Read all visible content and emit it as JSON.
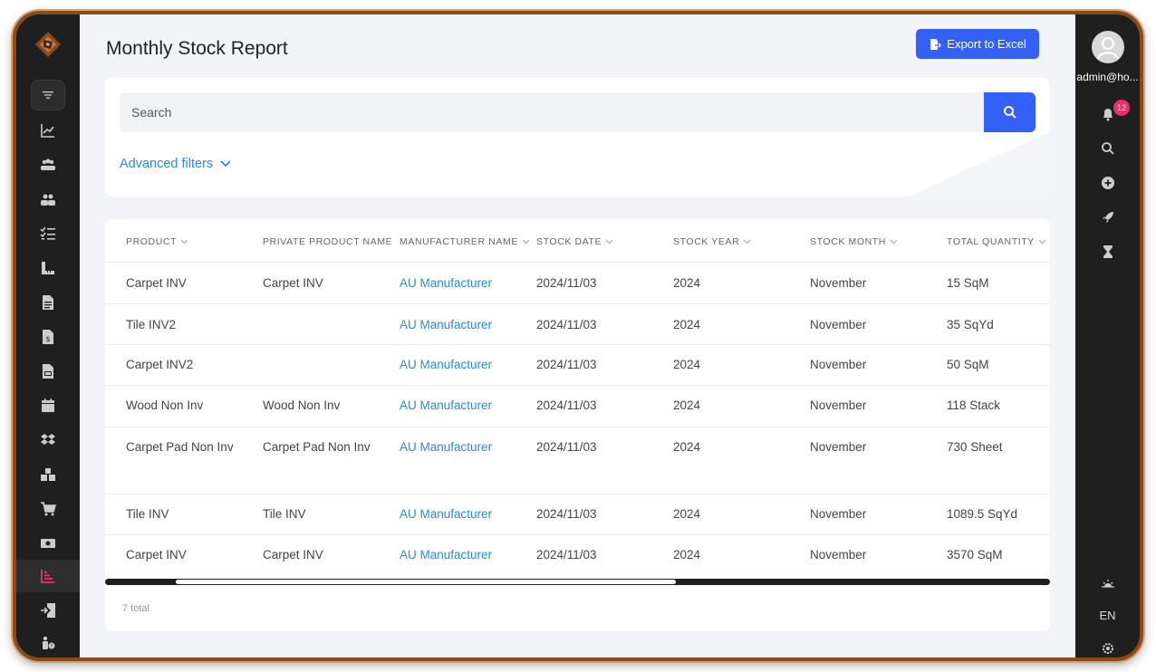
{
  "page": {
    "title": "Monthly Stock Report",
    "export_label": "Export to Excel"
  },
  "search": {
    "placeholder": "Search",
    "advanced_filters_label": "Advanced filters"
  },
  "table": {
    "columns": [
      "PRODUCT",
      "PRIVATE PRODUCT NAME",
      "MANUFACTURER NAME",
      "STOCK DATE",
      "STOCK YEAR",
      "STOCK MONTH",
      "TOTAL QUANTITY"
    ],
    "rows": [
      {
        "product": "Carpet INV",
        "private_name": "Carpet INV",
        "manufacturer": "AU Manufacturer",
        "stock_date": "2024/11/03",
        "stock_year": "2024",
        "stock_month": "November",
        "total_quantity": "15 SqM"
      },
      {
        "product": "Tile INV2",
        "private_name": "",
        "manufacturer": "AU Manufacturer",
        "stock_date": "2024/11/03",
        "stock_year": "2024",
        "stock_month": "November",
        "total_quantity": "35 SqYd"
      },
      {
        "product": "Carpet INV2",
        "private_name": "",
        "manufacturer": "AU Manufacturer",
        "stock_date": "2024/11/03",
        "stock_year": "2024",
        "stock_month": "November",
        "total_quantity": "50 SqM"
      },
      {
        "product": "Wood Non Inv",
        "private_name": "Wood Non Inv",
        "manufacturer": "AU Manufacturer",
        "stock_date": "2024/11/03",
        "stock_year": "2024",
        "stock_month": "November",
        "total_quantity": "118 Stack"
      },
      {
        "product": "Carpet Pad Non Inv",
        "private_name": "Carpet Pad Non Inv",
        "manufacturer": "AU Manufacturer",
        "stock_date": "2024/11/03",
        "stock_year": "2024",
        "stock_month": "November",
        "total_quantity": "730 Sheet"
      },
      {
        "product": "Tile INV",
        "private_name": "Tile INV",
        "manufacturer": "AU Manufacturer",
        "stock_date": "2024/11/03",
        "stock_year": "2024",
        "stock_month": "November",
        "total_quantity": "1089.5 SqYd"
      },
      {
        "product": "Carpet INV",
        "private_name": "Carpet INV",
        "manufacturer": "AU Manufacturer",
        "stock_date": "2024/11/03",
        "stock_year": "2024",
        "stock_month": "November",
        "total_quantity": "3570 SqM"
      }
    ],
    "total_label": "7 total"
  },
  "user": {
    "email": "admin@ho...",
    "notification_count": "12"
  },
  "language": "EN",
  "colors": {
    "accent": "#3461f5",
    "link": "#2b8ad8",
    "sidebar_bg": "#1f1f1f",
    "active_nav": "#e8306a",
    "badge": "#e8306a"
  },
  "icons": {
    "left_nav": [
      "filter-icon",
      "chart-line-icon",
      "users-group-icon",
      "users-icon",
      "checklist-icon",
      "ruler-icon",
      "document-icon",
      "invoice-icon",
      "report-doc-icon",
      "calendar-icon",
      "dropbox-icon",
      "boxes-icon",
      "cart-icon",
      "money-icon",
      "bar-chart-icon",
      "sign-in-icon",
      "user-help-icon"
    ],
    "right_nav": [
      "bell-icon",
      "search-icon",
      "plus-circle-icon",
      "rocket-icon",
      "hourglass-icon",
      "sun-icon",
      "gear-icon"
    ]
  }
}
